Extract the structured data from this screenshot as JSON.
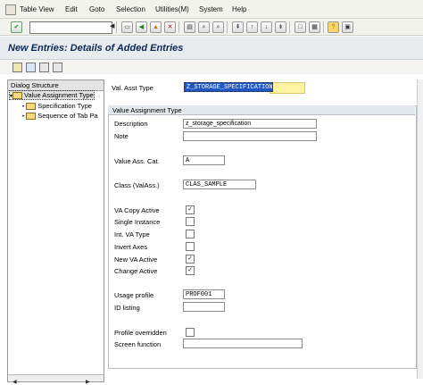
{
  "menubar": {
    "items": [
      "Table View",
      "Edit",
      "Goto",
      "Selection",
      "Utilities(M)",
      "System",
      "Help"
    ]
  },
  "toolbar": {
    "command_value": "",
    "icons": [
      "enter-icon",
      "save-icon",
      "back-icon",
      "exit-icon",
      "cancel-icon",
      "print-icon",
      "find-icon",
      "find-next-icon",
      "first-page-icon",
      "prev-page-icon",
      "next-page-icon",
      "last-page-icon",
      "create-session-icon",
      "shortcut-icon",
      "help-icon",
      "layout-icon"
    ]
  },
  "title": "New Entries: Details of Added Entries",
  "app_toolbar": {
    "icons": [
      "change-display-icon",
      "new-entries-icon",
      "copy-icon",
      "delete-icon"
    ]
  },
  "tree": {
    "header": "Dialog Structure",
    "items": [
      {
        "label": "Value Assignment Type",
        "level": 0,
        "selected": true
      },
      {
        "label": "Specification Type",
        "level": 1,
        "selected": false
      },
      {
        "label": "Sequence of Tab Pa",
        "level": 1,
        "selected": false
      }
    ]
  },
  "key": {
    "label": "Val. Asst Type",
    "value": "Z_STORAGE_SPECIFICATION"
  },
  "group": {
    "title": "Value Assignment Type",
    "description_label": "Description",
    "description_value": "z_storage_specification",
    "note_label": "Note",
    "note_value": "",
    "category_label": "Value Ass. Cat.",
    "category_value": "A",
    "class_label": "Class (ValAss.)",
    "class_value": "CLAS_SAMPLE",
    "checkboxes": [
      {
        "label": "VA Copy Active",
        "checked": true
      },
      {
        "label": "Single Instance",
        "checked": false
      },
      {
        "label": "Int. VA Type",
        "checked": false
      },
      {
        "label": "Invert Axes",
        "checked": false
      },
      {
        "label": "New VA Active",
        "checked": true
      },
      {
        "label": "Change Active",
        "checked": true
      }
    ],
    "usage_label": "Usage profile",
    "usage_value": "PROF001",
    "id_listing_label": "ID listing",
    "id_listing_value": "",
    "profile_overridden_label": "Profile overridden",
    "profile_overridden_checked": false,
    "screen_function_label": "Screen function",
    "screen_function_value": ""
  }
}
